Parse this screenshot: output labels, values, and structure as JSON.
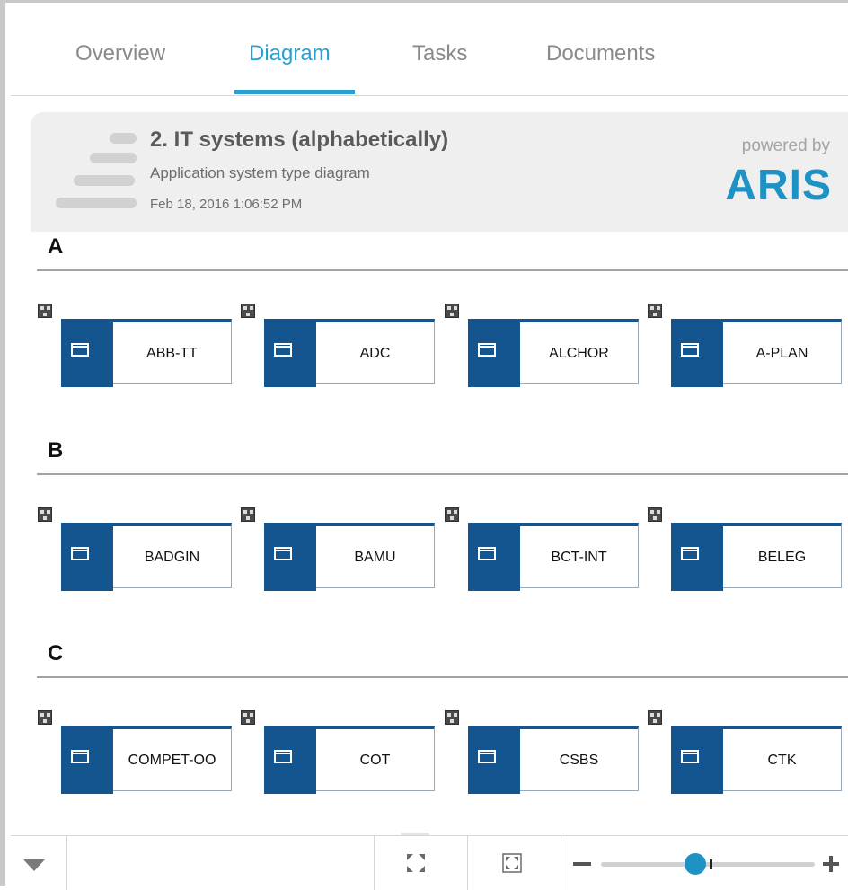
{
  "tabs": [
    {
      "label": "Overview"
    },
    {
      "label": "Diagram"
    },
    {
      "label": "Tasks"
    },
    {
      "label": "Documents"
    }
  ],
  "active_tab": "Diagram",
  "accent_color": "#2aa0d0",
  "header": {
    "title": "2. IT systems (alphabetically)",
    "subtitle": "Application system type diagram",
    "date": "Feb 18, 2016 1:06:52 PM",
    "powered_by": "powered by",
    "brand": "ARIS",
    "brand_color": "#1e92c4"
  },
  "card_color": "#15558f",
  "sections": [
    {
      "letter": "A",
      "items": [
        "ABB-TT",
        "ADC",
        "ALCHOR",
        "A-PLAN"
      ]
    },
    {
      "letter": "B",
      "items": [
        "BADGIN",
        "BAMU",
        "BCT-INT",
        "BELEG"
      ]
    },
    {
      "letter": "C",
      "items": [
        "COMPET-OO",
        "COT",
        "CSBS",
        "CTK"
      ]
    }
  ],
  "icons": {
    "card": "application-window-icon",
    "badge": "assigned-model-icon",
    "footer": [
      "chevron-down-icon",
      "fullscreen-icon",
      "fit-to-window-icon",
      "zoom-out-icon",
      "zoom-in-icon"
    ]
  },
  "zoom": {
    "level": 0.44
  }
}
